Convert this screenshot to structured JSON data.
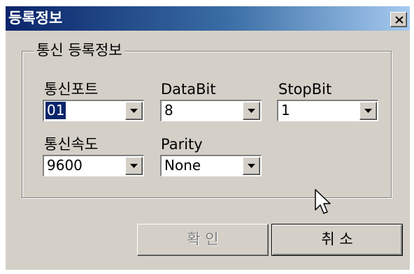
{
  "window": {
    "title": "등록정보",
    "close_glyph": "✕"
  },
  "group": {
    "legend": "통신 등록정보"
  },
  "fields": {
    "port": {
      "label": "통신포트",
      "value": "01"
    },
    "databit": {
      "label": "DataBit",
      "value": "8"
    },
    "stopbit": {
      "label": "StopBit",
      "value": "1"
    },
    "speed": {
      "label": "통신속도",
      "value": "9600"
    },
    "parity": {
      "label": "Parity",
      "value": "None"
    }
  },
  "buttons": {
    "ok": "확 인",
    "cancel": "취 소"
  },
  "icons": {
    "close": "close-icon",
    "dropdown": "chevron-down-icon",
    "cursor": "mouse-pointer-icon"
  },
  "colors": {
    "title_start": "#0a246a",
    "title_end": "#a6caf0",
    "face": "#d4d0c8",
    "selection": "#0a246a"
  }
}
